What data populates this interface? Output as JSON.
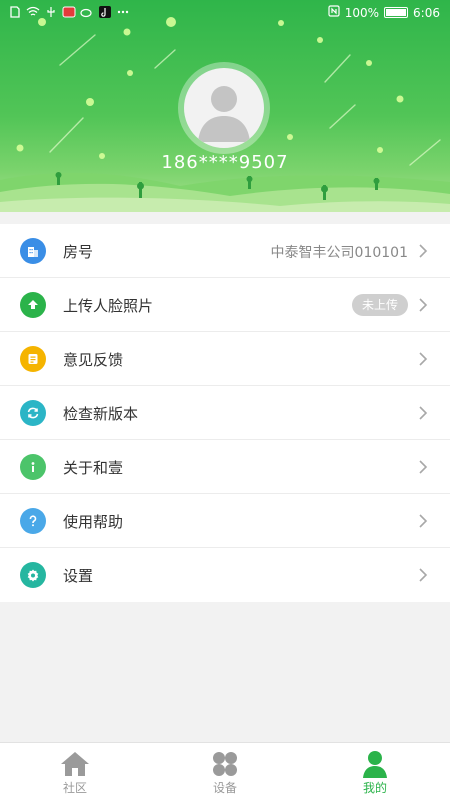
{
  "status_bar": {
    "battery": "100%",
    "time": "6:06"
  },
  "profile": {
    "phone": "186****9507"
  },
  "menu": [
    {
      "label": "房号",
      "value": "中泰智丰公司010101",
      "icon": "building-icon",
      "color": "#3a8ee6"
    },
    {
      "label": "上传人脸照片",
      "badge": "未上传",
      "icon": "upload-icon",
      "color": "#2bb34a"
    },
    {
      "label": "意见反馈",
      "icon": "feedback-icon",
      "color": "#f5b400"
    },
    {
      "label": "检查新版本",
      "icon": "refresh-icon",
      "color": "#2bb5c6"
    },
    {
      "label": "关于和壹",
      "icon": "info-icon",
      "color": "#4cc46a"
    },
    {
      "label": "使用帮助",
      "icon": "help-icon",
      "color": "#4aa8e8"
    },
    {
      "label": "设置",
      "icon": "gear-icon",
      "color": "#25b6a0"
    }
  ],
  "nav": [
    {
      "label": "社区",
      "icon": "home-icon"
    },
    {
      "label": "设备",
      "icon": "grid-icon"
    },
    {
      "label": "我的",
      "icon": "person-icon"
    }
  ],
  "colors": {
    "accent": "#2bb34a",
    "inactive": "#9a9a9a",
    "background": "#f2f2f2"
  }
}
